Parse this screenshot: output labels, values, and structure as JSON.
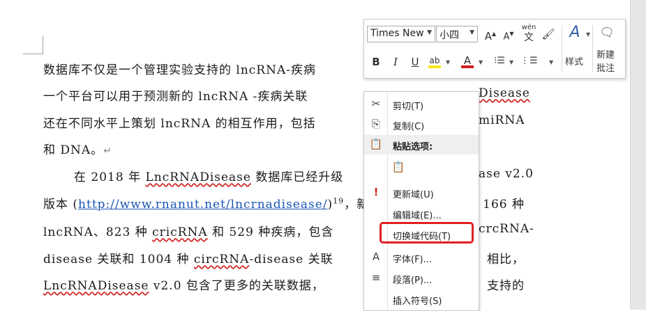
{
  "document": {
    "lines": [
      {
        "parts": [
          {
            "t": "数据库不仅是一个管理实验支持的 lncRNA-疾病"
          }
        ]
      },
      {
        "parts": [
          {
            "t": "一个平台可以用于预测新的 lncRNA -疾病关联 "
          },
          {
            "t": "Disease",
            "squig": true,
            "right": true
          }
        ]
      },
      {
        "parts": [
          {
            "t": "还在不同水平上策划 lncRNA 的相互作用，包括"
          },
          {
            "t": "miRNA",
            "right": true
          }
        ]
      },
      {
        "parts": [
          {
            "t": "和 DNA。"
          },
          {
            "t": "↵",
            "mark": true
          }
        ]
      },
      {
        "parts": [
          {
            "t": "在 2018 年 "
          },
          {
            "t": "LncRNADisease",
            "squig": true
          },
          {
            "t": " 数据库已经升级"
          },
          {
            "t": "ase v2.0",
            "right": true
          }
        ]
      },
      {
        "parts": [
          {
            "t": "版本 ("
          },
          {
            "t": "http://www.rnanut.net/lncrnadisease/",
            "link": true
          },
          {
            "t": ")"
          },
          {
            "t": "19",
            "sup": true
          },
          {
            "t": "，新"
          },
          {
            "t": "166  种",
            "right": true
          }
        ]
      },
      {
        "parts": [
          {
            "t": "lncRNA、823 种 "
          },
          {
            "t": "cricRNA",
            "squig": true
          },
          {
            "t": " 和 529 种疾病，包含"
          },
          {
            "t": "crcRNA-",
            "right": true
          }
        ]
      },
      {
        "parts": [
          {
            "t": "disease  关联和  1004  种  "
          },
          {
            "t": "circRNA",
            "squig": true
          },
          {
            "t": "-disease  关联"
          },
          {
            "t": "相比，",
            "right": true
          }
        ]
      },
      {
        "parts": [
          {
            "t": "LncRNADisease",
            "squig": true
          },
          {
            "t": " v2.0  包含了更多的关联数据，"
          },
          {
            "t": "支持的",
            "right": true
          }
        ]
      }
    ]
  },
  "mini_toolbar": {
    "font_name": "Times New",
    "font_size": "小四",
    "grow_font": "A",
    "shrink_font": "A",
    "phonetic_top": "wén",
    "phonetic_bottom": "文",
    "bold": "B",
    "italic": "I",
    "underline": "U",
    "font_color_letter": "A",
    "styles_label": "样式",
    "new_comment_line1": "新建",
    "new_comment_line2": "批注",
    "highlight_color": "#f5e61b",
    "font_color": "#d21f1f"
  },
  "context_menu": {
    "items": [
      {
        "label": "剪切(T)",
        "icon": "scissors-icon",
        "glyph": "✂"
      },
      {
        "label": "复制(C)",
        "icon": "copy-icon",
        "glyph": "⎘"
      },
      {
        "label": "粘贴选项:",
        "icon": "paste-icon",
        "glyph": "📋",
        "header": true
      },
      {
        "label": "",
        "icon": "paste-keep-text-icon",
        "glyph": "📋"
      },
      {
        "label": "更新域(U)",
        "icon": "update-field-icon",
        "glyph": "!"
      },
      {
        "label": "编辑域(E)...",
        "icon": "",
        "glyph": ""
      },
      {
        "label": "切换域代码(T)",
        "icon": "",
        "glyph": "",
        "highlighted": true
      },
      {
        "label": "字体(F)...",
        "icon": "font-icon",
        "glyph": "A"
      },
      {
        "label": "段落(P)...",
        "icon": "paragraph-icon",
        "glyph": "≡"
      },
      {
        "label": "插入符号(S)",
        "icon": "",
        "glyph": ""
      }
    ],
    "highlight_color": "#e02020"
  }
}
